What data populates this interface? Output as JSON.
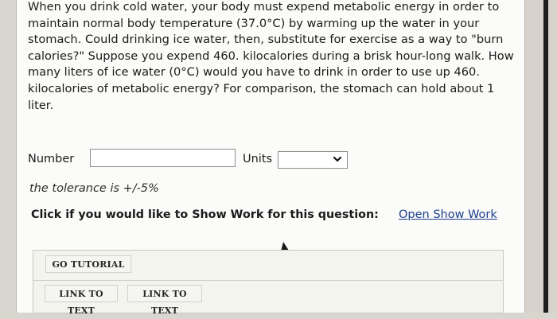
{
  "question": {
    "text": "When you drink cold water, your body must expend metabolic energy in order to maintain normal body temperature (37.0°C) by warming up the water in your stomach. Could drinking ice water, then, substitute for exercise as a way to \"burn calories?\" Suppose you expend 460. kilocalories during a brisk hour-long walk. How many liters of ice water (0°C) would you have to drink in order to use up 460. kilocalories of metabolic energy? For comparison, the stomach can hold about 1 liter."
  },
  "answer": {
    "number_label": "Number",
    "number_value": "",
    "units_label": "Units",
    "units_selected": ""
  },
  "tolerance": "the tolerance is +/-5%",
  "show_work": {
    "prompt": "Click if you would like to Show Work for this question:",
    "link": "Open Show Work"
  },
  "buttons": {
    "go_tutorial": "GO TUTORIAL",
    "link_to_text_1": "LINK TO TEXT",
    "link_to_text_2": "LINK TO TEXT"
  },
  "colors": {
    "link": "#1e3f8f",
    "panel_bg": "#fbfbf9",
    "tutorial_bg": "#f3f4ee"
  },
  "icons": [
    "chevron-down-icon",
    "mouse-pointer-icon"
  ]
}
